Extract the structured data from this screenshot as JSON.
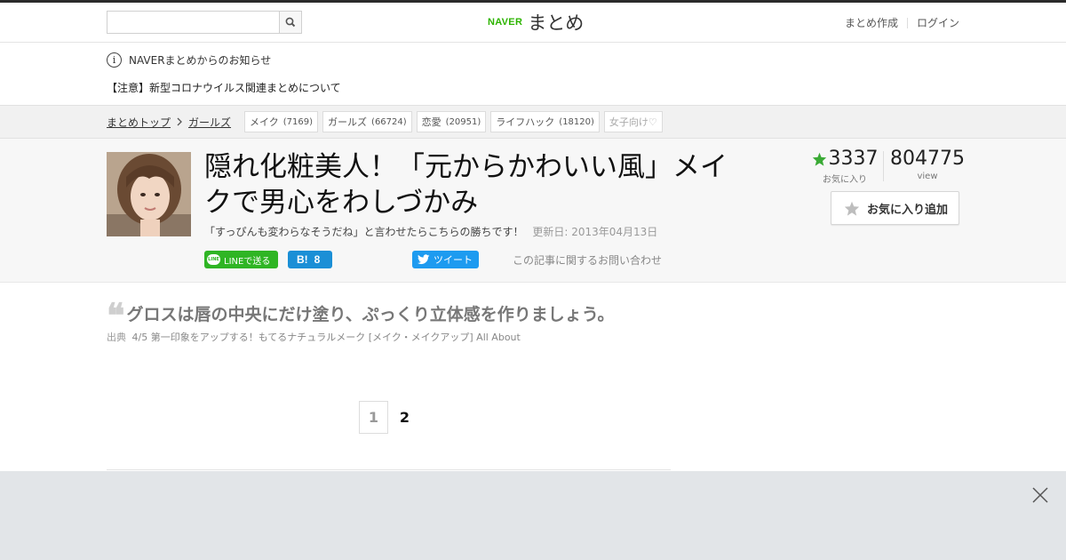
{
  "header": {
    "search_placeholder": "",
    "logo_brand": "NAVER",
    "logo_name": "まとめ",
    "links": [
      "まとめ作成",
      "ログイン"
    ]
  },
  "notice": {
    "info_glyph": "i",
    "heading": "NAVERまとめからのお知らせ",
    "link": "【注意】新型コロナウイルス関連まとめについて"
  },
  "breadcrumb": {
    "items": [
      "まとめトップ",
      "ガールズ"
    ],
    "tags": [
      {
        "label": "メイク",
        "count": "(7169)"
      },
      {
        "label": "ガールズ",
        "count": "(66724)"
      },
      {
        "label": "恋愛",
        "count": "(20951)"
      },
      {
        "label": "ライフハック",
        "count": "(18120)"
      },
      {
        "label": "女子向け♡",
        "count": ""
      }
    ]
  },
  "article": {
    "title": "隠れ化粧美人！「元からかわいい風」メイクで男心をわしづかみ",
    "subtitle": "「すっぴんも変わらなそうだね」と言わせたらこちらの勝ちです！",
    "updated": "更新日: 2013年04月13日",
    "share": {
      "line_label": "LINEで送る",
      "hatena_label": "B!",
      "hatena_count": "8",
      "tweet_label": "ツイート"
    },
    "contact_link": "この記事に関するお問い合わせ",
    "favorites_count": "3337",
    "favorites_label": "お気に入り",
    "views_count": "804775",
    "views_label": "view",
    "fav_button_label": "お気に入り追加"
  },
  "content": {
    "quote_mark": "❝",
    "quote": "グロスは唇の中央にだけ塗り、ぷっくり立体感を作りましょう。",
    "source_label": "出典",
    "source_link": "4/5 第一印象をアップする！もてるナチュラルメーク [メイク・メイクアップ] All About"
  },
  "pagination": {
    "pages": [
      "1",
      "2"
    ],
    "current": "1"
  },
  "colors": {
    "naver_green": "#2db400",
    "line_green": "#2fb524",
    "hatena_blue": "#1b8fd6",
    "twitter_blue": "#1d9bf0",
    "star_green": "#3aaa35"
  }
}
